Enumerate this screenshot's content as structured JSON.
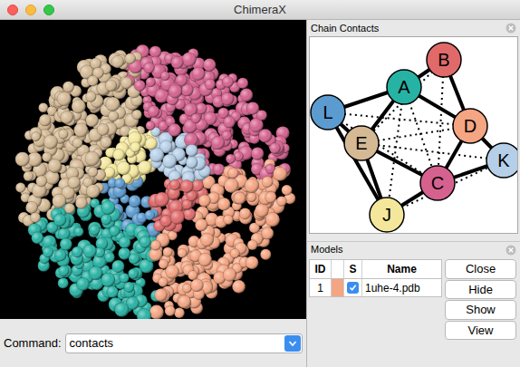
{
  "window": {
    "title": "ChimeraX"
  },
  "command": {
    "label": "Command:",
    "value": "contacts"
  },
  "chain_contacts": {
    "title": "Chain Contacts",
    "nodes": [
      {
        "label": "A",
        "color": "#27b3a4"
      },
      {
        "label": "B",
        "color": "#e06a6a"
      },
      {
        "label": "L",
        "color": "#5c9bd0"
      },
      {
        "label": "E",
        "color": "#d4b994"
      },
      {
        "label": "D",
        "color": "#f4a582"
      },
      {
        "label": "K",
        "color": "#b5cfe8"
      },
      {
        "label": "C",
        "color": "#d5628e"
      },
      {
        "label": "J",
        "color": "#f4e79c"
      }
    ],
    "edges": [
      {
        "from": "A",
        "to": "B",
        "kind": "solid"
      },
      {
        "from": "A",
        "to": "L",
        "kind": "solid"
      },
      {
        "from": "A",
        "to": "E",
        "kind": "solid"
      },
      {
        "from": "A",
        "to": "D",
        "kind": "solid"
      },
      {
        "from": "B",
        "to": "D",
        "kind": "solid"
      },
      {
        "from": "L",
        "to": "E",
        "kind": "solid"
      },
      {
        "from": "L",
        "to": "J",
        "kind": "solid"
      },
      {
        "from": "E",
        "to": "J",
        "kind": "solid"
      },
      {
        "from": "E",
        "to": "C",
        "kind": "solid"
      },
      {
        "from": "C",
        "to": "J",
        "kind": "solid"
      },
      {
        "from": "C",
        "to": "D",
        "kind": "solid"
      },
      {
        "from": "C",
        "to": "K",
        "kind": "solid"
      },
      {
        "from": "D",
        "to": "K",
        "kind": "solid"
      },
      {
        "from": "A",
        "to": "C",
        "kind": "dotted"
      },
      {
        "from": "A",
        "to": "J",
        "kind": "dotted"
      },
      {
        "from": "B",
        "to": "C",
        "kind": "dotted"
      },
      {
        "from": "B",
        "to": "E",
        "kind": "dotted"
      },
      {
        "from": "L",
        "to": "D",
        "kind": "dotted"
      },
      {
        "from": "L",
        "to": "C",
        "kind": "dotted"
      },
      {
        "from": "E",
        "to": "K",
        "kind": "dotted"
      },
      {
        "from": "J",
        "to": "K",
        "kind": "dotted"
      },
      {
        "from": "E",
        "to": "D",
        "kind": "dotted"
      }
    ]
  },
  "models": {
    "title": "Models",
    "columns": [
      "ID",
      "",
      "S",
      "Name"
    ],
    "rows": [
      {
        "id": "1",
        "color": "#f4a582",
        "shown": true,
        "name": "1uhe-4.pdb"
      }
    ],
    "buttons": [
      "Close",
      "Hide",
      "Show",
      "View"
    ]
  }
}
